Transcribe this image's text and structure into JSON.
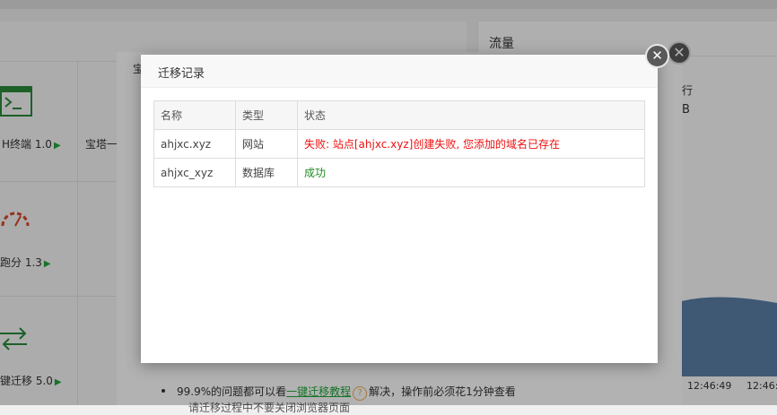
{
  "background": {
    "tools": [
      {
        "label": "H终端 1.0"
      },
      {
        "label": "宝塔一"
      },
      {
        "label": "跑分 1.3"
      },
      {
        "label": "键迁移 5.0"
      }
    ],
    "traffic_title": "流量",
    "traffic_side1": "行",
    "traffic_side2": "B",
    "times": [
      "12:46:49",
      "12:46:5"
    ],
    "modal_tab": "宝",
    "bullet_prefix": "99.9%的问题都可以看",
    "bullet_link": "一键迁移教程",
    "bullet_help": "?",
    "bullet_suffix": "解决，操作前必须花1分钟查看",
    "bullet2": "请迁移过程中不要关闭浏览器页面"
  },
  "dialog": {
    "title": "迁移记录",
    "close_glyph": "✕",
    "columns": [
      "名称",
      "类型",
      "状态"
    ],
    "rows": [
      {
        "name": "ahjxc.xyz",
        "type": "网站",
        "status": "失败: 站点[ahjxc.xyz]创建失败, 您添加的域名已存在",
        "status_kind": "fail"
      },
      {
        "name": "ahjxc_xyz",
        "type": "数据库",
        "status": "成功",
        "status_kind": "ok"
      }
    ]
  },
  "colors": {
    "fail": "#ee1111",
    "success": "#208a20",
    "accent": "#20a53a"
  }
}
